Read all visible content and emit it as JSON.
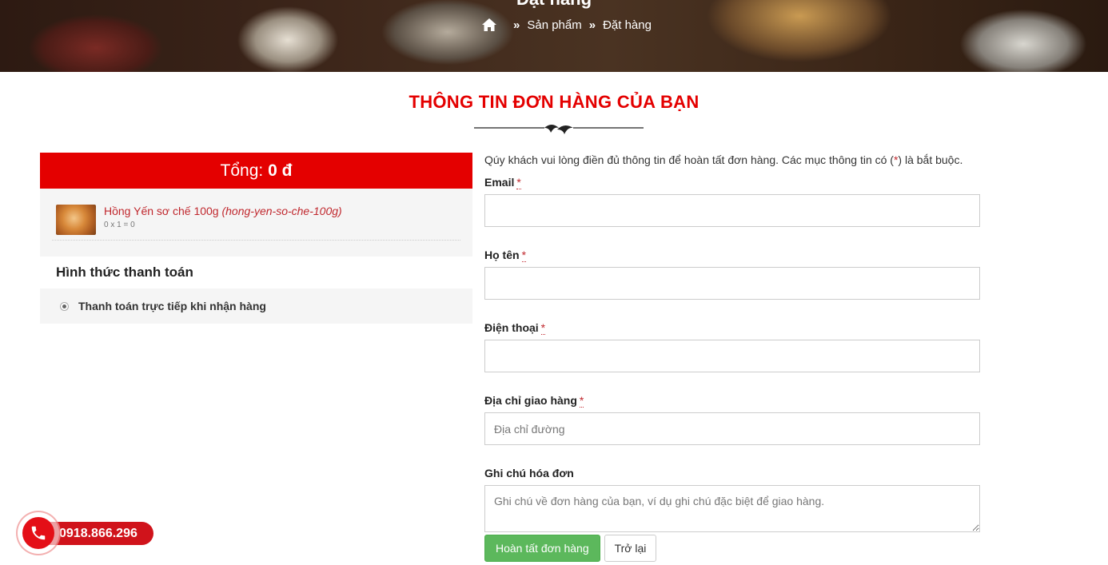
{
  "banner": {
    "title": "Đặt hàng",
    "breadcrumb": [
      "Sản phẩm",
      "Đặt hàng"
    ],
    "separator": "»"
  },
  "heading": "THÔNG TIN ĐƠN HÀNG CỦA BẠN",
  "order": {
    "total_label": "Tổng:",
    "total_value": "0 đ",
    "items": [
      {
        "name": "Hồng Yến sơ chế 100g",
        "slug": "(hong-yen-so-che-100g)",
        "calc": "0 x 1 = 0"
      }
    ]
  },
  "payment": {
    "title": "Hình thức thanh toán",
    "option": "Thanh toán trực tiếp khi nhận hàng"
  },
  "form": {
    "note_prefix": "Qúy khách vui lòng điền đủ thông tin để hoàn tất đơn hàng. Các mục thông tin có (",
    "note_star": "*",
    "note_suffix": ") là bắt buộc.",
    "email_label": "Email",
    "name_label": "Họ tên",
    "phone_label": "Điện thoại",
    "address_label": "Địa chỉ giao hàng",
    "address_placeholder": "Địa chỉ đường",
    "note_label": "Ghi chú hóa đơn",
    "note_placeholder": "Ghi chú về đơn hàng của bạn, ví dụ ghi chú đặc biệt để giao hàng.",
    "required_mark": "*",
    "submit": "Hoàn tất đơn hàng",
    "back": "Trở lại"
  },
  "hotline": {
    "number": "0918.866.296"
  },
  "colors": {
    "accent": "#e40000",
    "success": "#5cb85c",
    "link": "#c0272d"
  }
}
